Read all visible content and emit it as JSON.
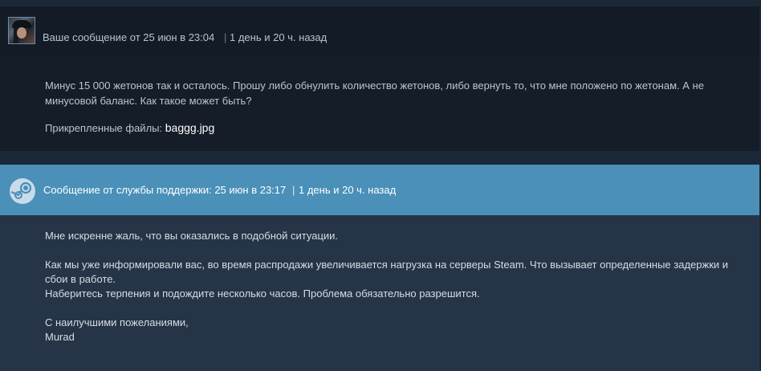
{
  "user_message": {
    "header": {
      "prefix": "Ваше сообщение от 25 июн в 23:04",
      "separator": "|",
      "ago": "1 день и 20 ч. назад"
    },
    "body": "Минус 15 000 жетонов так и осталось. Прошу либо обнулить количество жетонов, либо вернуть то, что мне положено по жетонам. А не минусовой баланс. Как такое может быть?",
    "attachments_label": "Прикрепленные файлы:",
    "attachment_file": "baggg.jpg"
  },
  "support_message": {
    "header": {
      "prefix": "Сообщение от службы поддержки: 25 июн в 23:17",
      "separator": "|",
      "ago": "1 день и 20 ч. назад"
    },
    "lines": [
      "Мне искренне жаль, что вы оказались в подобной ситуации.",
      "",
      "Как мы уже информировали вас, во время распродажи увеличивается нагрузка на серверы Steam. Что вызывает определенные задержки и сбои в работе.",
      "Наберитесь терпения и подождите несколько часов. Проблема обязательно разрешится.",
      "",
      "С наилучшими пожеланиями,",
      "Murad"
    ]
  },
  "icons": {
    "user_avatar": "user-avatar-icon",
    "steam_logo": "steam-logo-icon"
  },
  "colors": {
    "page_bg": "#1b2838",
    "user_msg_bg": "#141d28",
    "support_header_bg": "#4a90b8",
    "support_body_bg": "#263447",
    "link": "#ffffff"
  }
}
